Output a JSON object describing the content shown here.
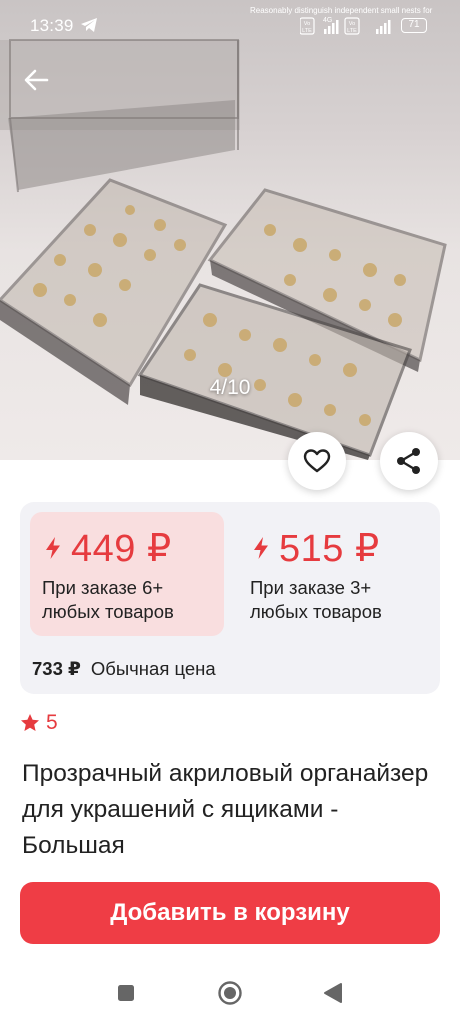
{
  "status_bar": {
    "time": "13:39",
    "watermark": "Reasonably distinguish independent small nests for",
    "network": "4G",
    "battery": "71",
    "icons": [
      "telegram-icon",
      "volte-icon",
      "signal-icon",
      "wifi-icon",
      "battery-icon"
    ]
  },
  "gallery": {
    "page_indicator": "4/10",
    "icons": [
      "arrow-left-icon",
      "heart-icon",
      "share-icon"
    ]
  },
  "prices": {
    "options": [
      {
        "price": "449 ₽",
        "condition": "При заказе 6+ любых товаров",
        "selected": true
      },
      {
        "price": "515 ₽",
        "condition": "При заказе 3+ любых товаров",
        "selected": false
      }
    ],
    "regular": {
      "amount": "733 ₽",
      "label": "Обычная цена"
    },
    "accent_color": "#e63b3f",
    "selected_bg": "#f9dedf",
    "card_bg": "#f2f2f6"
  },
  "rating": {
    "value": "5",
    "icon": "star-icon"
  },
  "product": {
    "title": "Прозрачный акриловый органайзер для украшений с ящиками - Большая"
  },
  "cart": {
    "button_label": "Добавить в корзину",
    "button_color": "#ef3d45"
  },
  "navbar": {
    "icons": [
      "square-icon",
      "circle-icon",
      "triangle-back-icon"
    ]
  }
}
